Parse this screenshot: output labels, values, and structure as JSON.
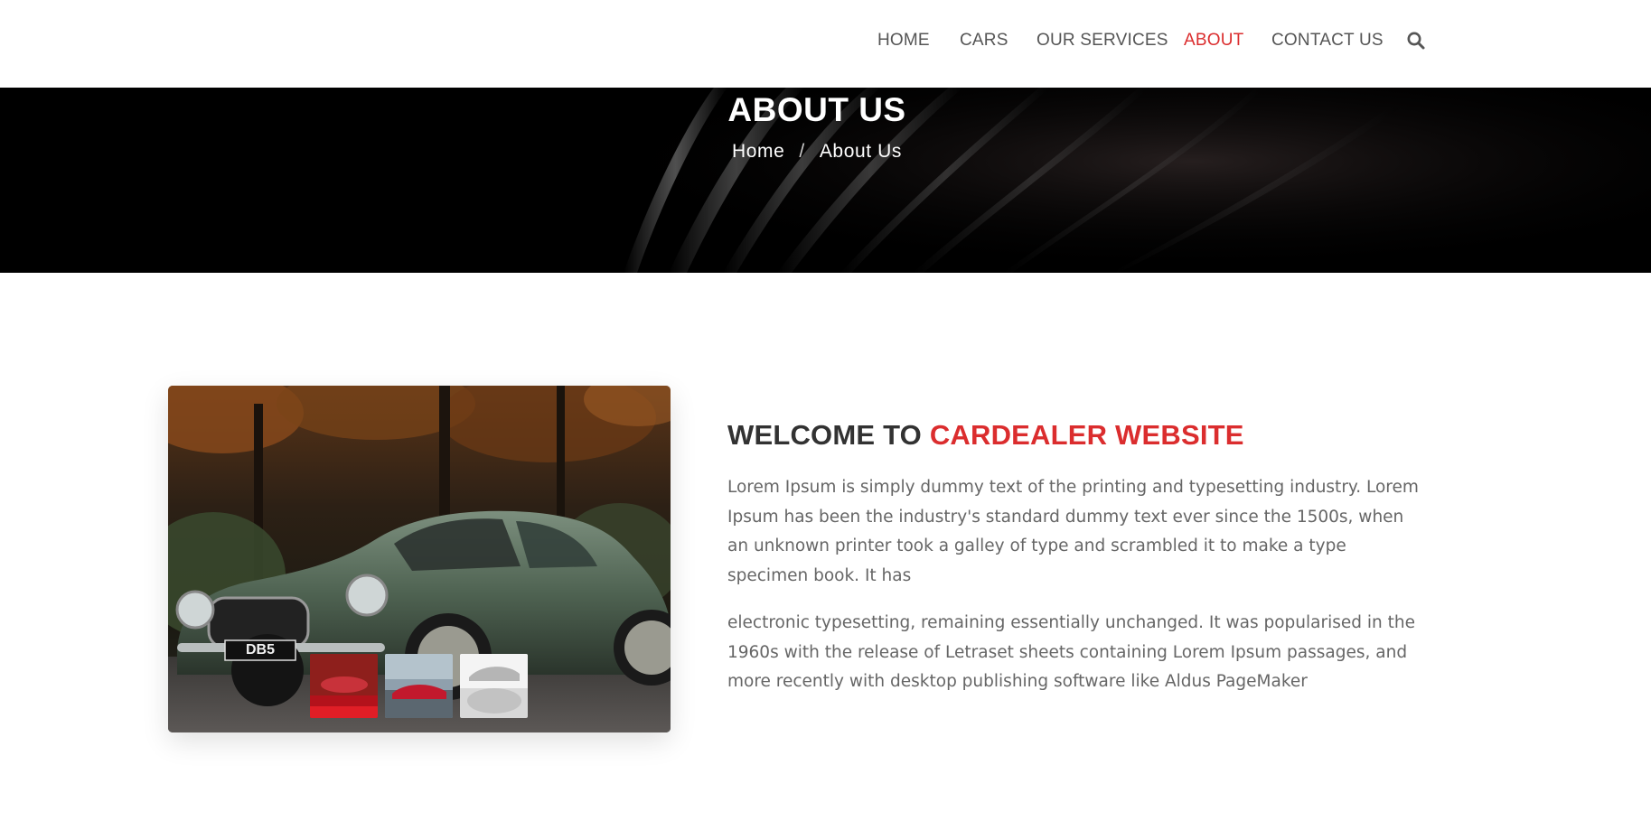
{
  "nav": {
    "items": [
      {
        "label": "HOME",
        "active": false
      },
      {
        "label": "CARS",
        "active": false
      },
      {
        "label": "OUR SERVICES",
        "active": false
      },
      {
        "label": "ABOUT",
        "active": true
      },
      {
        "label": "CONTACT US",
        "active": false
      }
    ],
    "search_icon": "search-icon"
  },
  "banner": {
    "title": "ABOUT US",
    "breadcrumb": {
      "home": "Home",
      "separator": "/",
      "current": "About Us"
    }
  },
  "about": {
    "heading_prefix": "WELCOME TO",
    "heading_accent": "CARDEALER WEBSITE",
    "paragraph1": "Lorem Ipsum is simply dummy text of the printing and typesetting industry. Lorem Ipsum has been the industry's standard dummy text ever since the 1500s, when an unknown printer took a galley of type and scrambled it to make a type specimen book. It has",
    "paragraph2": "electronic typesetting, remaining essentially unchanged. It was popularised in the 1960s with the release of Letraset sheets containing Lorem Ipsum passages, and more recently with desktop publishing software like Aldus PageMaker",
    "plate_text": "DB5"
  },
  "colors": {
    "accent": "#db2d2e",
    "heading": "#323232",
    "body_text": "#666666",
    "nav_text": "#555555"
  }
}
